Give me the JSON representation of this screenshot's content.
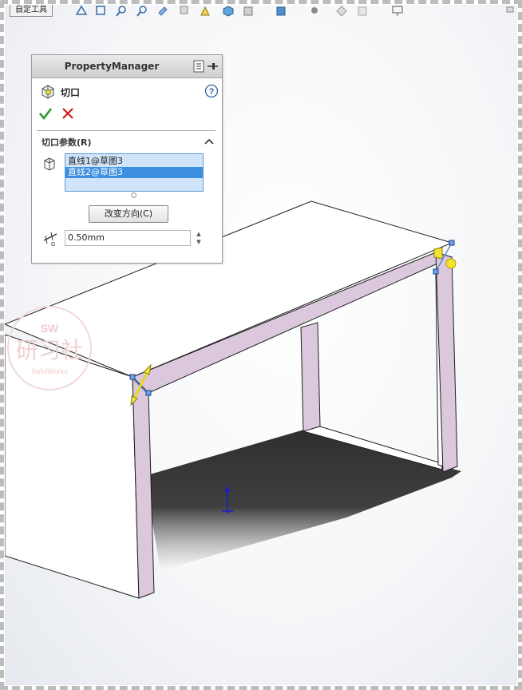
{
  "toolbar": {
    "partial_button_label": "自定工具"
  },
  "property_manager": {
    "title": "PropertyManager",
    "feature_name": "切口",
    "group_title": "切口参数(R)",
    "selections": [
      {
        "label": "直线1@草图3",
        "selected": false
      },
      {
        "label": "直线2@草图3",
        "selected": true
      }
    ],
    "reverse_button_label": "改变方向(C)",
    "gap_value": "0.50mm"
  },
  "watermark": {
    "line1": "SW",
    "line2": "研习社",
    "line3": "SolidWorks"
  },
  "colors": {
    "face_highlight": "#dcc8dc",
    "handle_yellow": "#f2e62c",
    "ok_green": "#2e9a2e",
    "cancel_red": "#d21a1a",
    "selection_blue": "#3d8fe0",
    "triad_blue": "#1a1ad6"
  },
  "icons": {
    "ok": "check-icon",
    "cancel": "close-icon",
    "help": "help-icon",
    "feature": "rip-feature-icon",
    "pin": "pin-icon",
    "selection": "edge-select-icon",
    "gap": "gap-distance-icon"
  }
}
